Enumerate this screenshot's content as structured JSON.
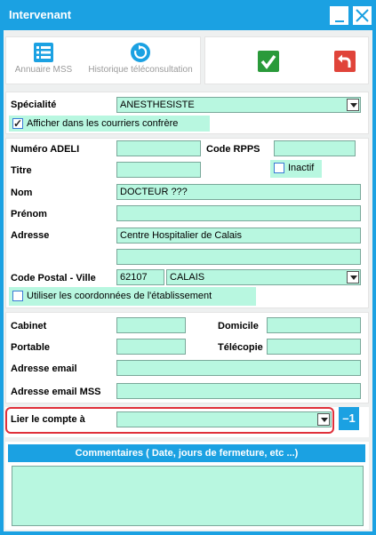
{
  "window": {
    "title": "Intervenant"
  },
  "toolbar": {
    "annuaire_label": "Annuaire MSS",
    "historique_label": "Historique téléconsultation"
  },
  "form": {
    "specialite_label": "Spécialité",
    "specialite_value": "ANESTHESISTE",
    "afficher_courriers_label": "Afficher dans les courriers confrère",
    "numero_adeli_label": "Numéro ADELI",
    "numero_adeli_value": "",
    "code_rpps_label": "Code RPPS",
    "code_rpps_value": "",
    "titre_label": "Titre",
    "titre_value": "",
    "inactif_label": "Inactif",
    "nom_label": "Nom",
    "nom_value": "DOCTEUR ???",
    "prenom_label": "Prénom",
    "prenom_value": "",
    "adresse_label": "Adresse",
    "adresse_value1": "Centre Hospitalier de Calais",
    "adresse_value2": "",
    "cp_ville_label": "Code Postal  - Ville",
    "code_postal_value": "62107",
    "ville_value": "CALAIS",
    "utiliser_coords_label": "Utiliser les coordonnées de l'établissement",
    "cabinet_label": "Cabinet",
    "cabinet_value": "",
    "domicile_label": "Domicile",
    "domicile_value": "",
    "portable_label": "Portable",
    "portable_value": "",
    "telecopie_label": "Télécopie",
    "telecopie_value": "",
    "email_label": "Adresse email",
    "email_value": "",
    "email_mss_label": "Adresse email MSS",
    "email_mss_value": "",
    "lier_label": "Lier le compte à",
    "lier_value": "",
    "lier_button_label": "–1"
  },
  "comments": {
    "header": "Commentaires ( Date, jours de fermeture, etc ...)",
    "value": ""
  },
  "colors": {
    "accent": "#1ba1e2",
    "field": "#b8f7e0",
    "highlight_border": "#e0303a"
  },
  "state": {
    "afficher_courriers_checked": true,
    "inactif_checked": false,
    "utiliser_coords_checked": false
  }
}
